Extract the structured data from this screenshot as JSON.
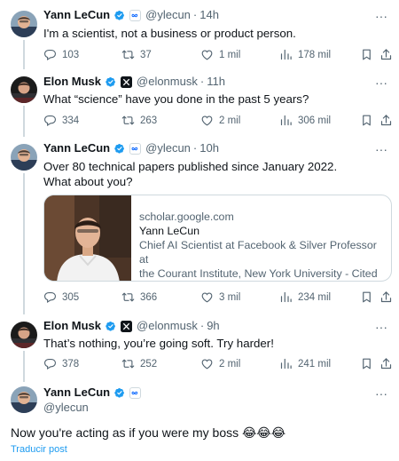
{
  "tweets": [
    {
      "name": "Yann LeCun",
      "handle": "@ylecun",
      "time": "14h",
      "text": "I'm a scientist, not a business or product person.",
      "stats": {
        "replies": "103",
        "reposts": "37",
        "likes": "1 mil",
        "views": "178 mil"
      }
    },
    {
      "name": "Elon Musk",
      "handle": "@elonmusk",
      "time": "11h",
      "text": "What “science” have you done in the past 5 years?",
      "stats": {
        "replies": "334",
        "reposts": "263",
        "likes": "2 mil",
        "views": "306 mil"
      }
    },
    {
      "name": "Yann LeCun",
      "handle": "@ylecun",
      "time": "10h",
      "text_line1": "Over 80 technical papers published since January 2022.",
      "text_line2": "What about you?",
      "card": {
        "domain": "scholar.google.com",
        "title": "Yann LeCun",
        "desc_line1": "Chief AI Scientist at Facebook & Silver Professor at",
        "desc_line2": "the Courant Institute, New York University - Cited b..."
      },
      "stats": {
        "replies": "305",
        "reposts": "366",
        "likes": "3 mil",
        "views": "234 mil"
      }
    },
    {
      "name": "Elon Musk",
      "handle": "@elonmusk",
      "time": "9h",
      "text": "That’s nothing, you’re going soft. Try harder!",
      "stats": {
        "replies": "378",
        "reposts": "252",
        "likes": "2 mil",
        "views": "241 mil"
      }
    }
  ],
  "main_tweet": {
    "name": "Yann LeCun",
    "handle": "@ylecun",
    "text": "Now you're acting as if you were my boss",
    "emojis": "😂😂😂",
    "translate_label": "Traducir post"
  },
  "colors": {
    "verified": "#1d9bf0",
    "muted": "#536471",
    "link": "#1d9bf0",
    "thread_line": "#cfd9de"
  },
  "icons": [
    "verified-badge",
    "affiliate-badge",
    "x-badge",
    "reply-icon",
    "repost-icon",
    "like-icon",
    "views-icon",
    "bookmark-icon",
    "share-icon",
    "more-icon"
  ]
}
